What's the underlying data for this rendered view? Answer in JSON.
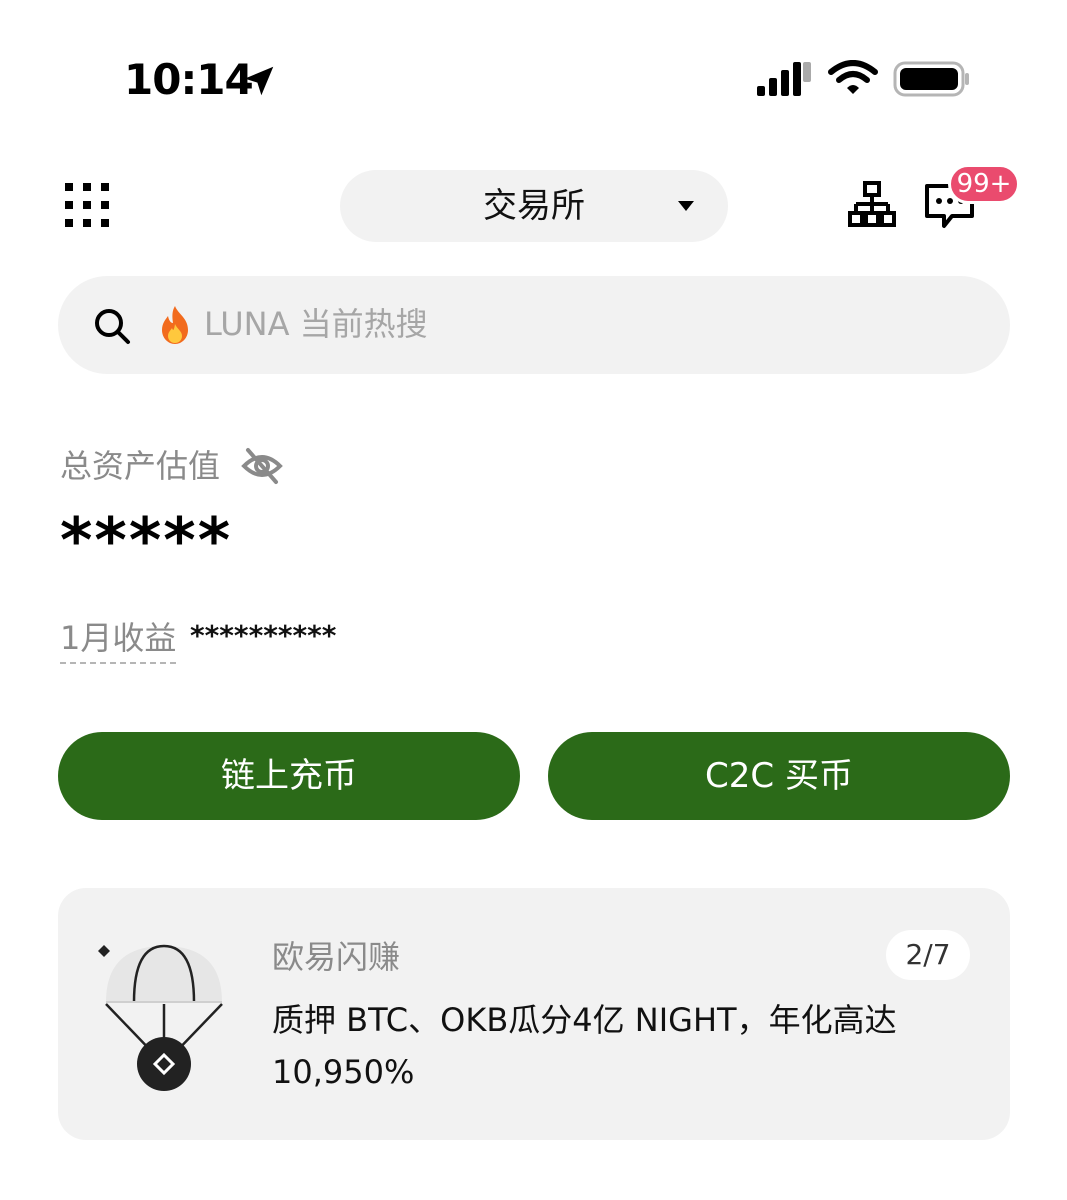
{
  "status_bar": {
    "time": "10:14"
  },
  "header": {
    "segment_label": "交易所",
    "badge_count": "99+"
  },
  "search": {
    "placeholder": "LUNA 当前热搜"
  },
  "assets": {
    "total_label": "总资产估值",
    "total_value": "*****",
    "profit_label": "1月收益",
    "profit_value": "**********"
  },
  "actions": {
    "deposit_label": "链上充币",
    "buy_label": "C2C 买币"
  },
  "promo": {
    "tag": "欧易闪赚",
    "page": "2/7",
    "text": "质押 BTC、OKB瓜分4亿 NIGHT，年化高达 10,950%"
  },
  "colors": {
    "primary_button": "#2b6a18",
    "badge": "#ea4b6e",
    "surface": "#f2f2f2"
  },
  "icons": [
    "location-arrow-icon",
    "signal-icon",
    "wifi-icon",
    "battery-icon",
    "grid-menu-icon",
    "caret-down-icon",
    "network-tree-icon",
    "message-icon",
    "search-icon",
    "fire-icon",
    "eye-off-icon",
    "parachute-icon"
  ]
}
